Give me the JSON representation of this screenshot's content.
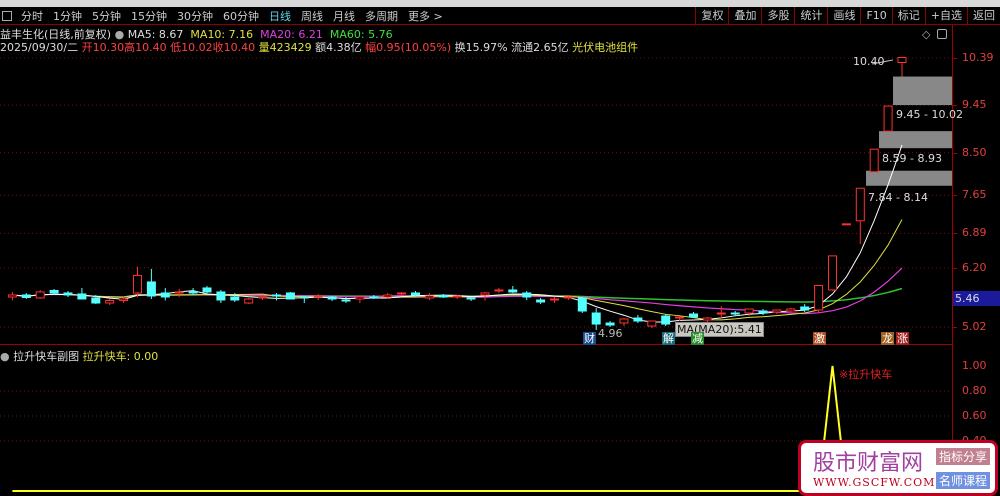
{
  "toolbar": {
    "tabs": [
      "分时",
      "1分钟",
      "5分钟",
      "15分钟",
      "30分钟",
      "60分钟",
      "日线",
      "周线",
      "月线",
      "多周期",
      "更多 >"
    ],
    "active": "日线",
    "right": [
      "复权",
      "叠加",
      "多股",
      "统计",
      "画线",
      "F10",
      "标记",
      "+自选",
      "返回"
    ]
  },
  "info": {
    "title": "益丰生化(日线,前复权)",
    "ma5": "MA5: 8.67",
    "ma10": "MA10: 7.16",
    "ma20": "MA20: 6.21",
    "ma60": "MA60: 5.76",
    "date": "2025/09/30/二",
    "open": "开10.30",
    "high": "高10.40",
    "low": "低10.02",
    "close": "收10.40",
    "vol": "量423429",
    "amount": "额4.38亿",
    "change": "幅0.95(10.05%)",
    "turnover": "换15.97%",
    "float": "流通2.65亿",
    "sector": "光伏电池组件"
  },
  "axis": {
    "ticks": [
      "10.39",
      "9.45",
      "8.50",
      "7.65",
      "6.89",
      "6.20",
      "5.02"
    ],
    "current": "5.46",
    "sub_ticks": [
      "1.00",
      "0.80",
      "0.60",
      "0.40"
    ]
  },
  "annotations": {
    "high_label": "10.40",
    "low_label": "4.96",
    "tooltip": "MA(MA20):5.41",
    "zones": [
      "9.45 - 10.02",
      "8.59 - 8.93",
      "7.84 - 8.14"
    ],
    "markers": [
      "财",
      "解",
      "减",
      "激",
      "龙",
      "涨"
    ],
    "signal": "※拉升快车"
  },
  "sub": {
    "title": "拉升快车副图",
    "value": "拉升快车: 0.00"
  },
  "colors": {
    "up": "#ff3030",
    "down": "#54ffff",
    "ma5": "#ffffff",
    "ma10": "#e0e040",
    "ma20": "#e040e0",
    "ma60": "#30c030"
  },
  "watermark": {
    "name": "股市财富网",
    "url": "WWW.GSCFW.COM",
    "badge1": "指标分享",
    "badge2": "名师课程"
  },
  "chart_data": {
    "type": "candlestick",
    "ohlc": [
      [
        5.62,
        5.72,
        5.55,
        5.66
      ],
      [
        5.66,
        5.7,
        5.58,
        5.61
      ],
      [
        5.6,
        5.76,
        5.58,
        5.72
      ],
      [
        5.75,
        5.78,
        5.66,
        5.7
      ],
      [
        5.7,
        5.74,
        5.62,
        5.66
      ],
      [
        5.68,
        5.8,
        5.6,
        5.58
      ],
      [
        5.6,
        5.66,
        5.48,
        5.5
      ],
      [
        5.5,
        5.58,
        5.46,
        5.55
      ],
      [
        5.55,
        5.62,
        5.5,
        5.58
      ],
      [
        5.7,
        6.22,
        5.62,
        6.05
      ],
      [
        5.92,
        6.18,
        5.58,
        5.64
      ],
      [
        5.7,
        5.8,
        5.55,
        5.62
      ],
      [
        5.7,
        5.78,
        5.62,
        5.72
      ],
      [
        5.73,
        5.8,
        5.65,
        5.7
      ],
      [
        5.8,
        5.84,
        5.68,
        5.72
      ],
      [
        5.72,
        5.76,
        5.5,
        5.56
      ],
      [
        5.62,
        5.7,
        5.52,
        5.56
      ],
      [
        5.5,
        5.6,
        5.48,
        5.58
      ],
      [
        5.62,
        5.66,
        5.56,
        5.62
      ],
      [
        5.66,
        5.7,
        5.55,
        5.64
      ],
      [
        5.7,
        5.72,
        5.58,
        5.58
      ],
      [
        5.62,
        5.64,
        5.5,
        5.6
      ],
      [
        5.62,
        5.68,
        5.56,
        5.64
      ],
      [
        5.62,
        5.64,
        5.54,
        5.58
      ],
      [
        5.56,
        5.62,
        5.5,
        5.54
      ],
      [
        5.58,
        5.62,
        5.5,
        5.62
      ],
      [
        5.62,
        5.66,
        5.58,
        5.6
      ],
      [
        5.62,
        5.7,
        5.58,
        5.66
      ],
      [
        5.68,
        5.72,
        5.64,
        5.7
      ],
      [
        5.7,
        5.74,
        5.62,
        5.66
      ],
      [
        5.6,
        5.7,
        5.56,
        5.64
      ],
      [
        5.65,
        5.68,
        5.6,
        5.62
      ],
      [
        5.62,
        5.66,
        5.58,
        5.64
      ],
      [
        5.6,
        5.62,
        5.54,
        5.58
      ],
      [
        5.66,
        5.72,
        5.55,
        5.7
      ],
      [
        5.76,
        5.8,
        5.7,
        5.76
      ],
      [
        5.76,
        5.84,
        5.7,
        5.72
      ],
      [
        5.7,
        5.74,
        5.56,
        5.62
      ],
      [
        5.56,
        5.6,
        5.48,
        5.52
      ],
      [
        5.56,
        5.62,
        5.5,
        5.58
      ],
      [
        5.62,
        5.66,
        5.56,
        5.62
      ],
      [
        5.6,
        5.62,
        5.3,
        5.34
      ],
      [
        5.3,
        5.4,
        4.96,
        5.08
      ],
      [
        5.1,
        5.14,
        5.02,
        5.06
      ],
      [
        5.1,
        5.2,
        5.04,
        5.18
      ],
      [
        5.2,
        5.26,
        5.1,
        5.14
      ],
      [
        5.04,
        5.12,
        5.0,
        5.14
      ],
      [
        5.24,
        5.28,
        5.04,
        5.08
      ],
      [
        5.2,
        5.24,
        5.14,
        5.22
      ],
      [
        5.28,
        5.32,
        5.2,
        5.22
      ],
      [
        5.16,
        5.22,
        5.08,
        5.2
      ],
      [
        5.3,
        5.44,
        5.2,
        5.3
      ],
      [
        5.3,
        5.34,
        5.24,
        5.28
      ],
      [
        5.3,
        5.36,
        5.24,
        5.38
      ],
      [
        5.34,
        5.38,
        5.26,
        5.3
      ],
      [
        5.32,
        5.36,
        5.28,
        5.36
      ],
      [
        5.34,
        5.4,
        5.3,
        5.38
      ],
      [
        5.42,
        5.48,
        5.32,
        5.36
      ],
      [
        5.36,
        5.86,
        5.3,
        5.85
      ],
      [
        5.76,
        6.44,
        5.74,
        6.44
      ],
      [
        7.08,
        7.08,
        7.08,
        7.08
      ],
      [
        7.14,
        7.79,
        6.68,
        7.79
      ],
      [
        8.12,
        8.57,
        8.12,
        8.57
      ],
      [
        8.93,
        9.43,
        8.93,
        9.43
      ],
      [
        10.3,
        10.4,
        10.02,
        10.4
      ]
    ],
    "sub_values": [
      0,
      0,
      0,
      0,
      0,
      0,
      0,
      0,
      0,
      0,
      0,
      0,
      0,
      0,
      0,
      0,
      0,
      0,
      0,
      0,
      0,
      0,
      0,
      0,
      0,
      0,
      0,
      0,
      0,
      0,
      0,
      0,
      0,
      0,
      0,
      0,
      0,
      0,
      0,
      0,
      0,
      0,
      0,
      0,
      0,
      0,
      0,
      0,
      0,
      0,
      0,
      0,
      0,
      0,
      0,
      0,
      0,
      0,
      0,
      1,
      0,
      0,
      0,
      0,
      0
    ],
    "ylim": [
      5.02,
      10.39
    ],
    "sub_ylim": [
      0,
      1
    ]
  }
}
